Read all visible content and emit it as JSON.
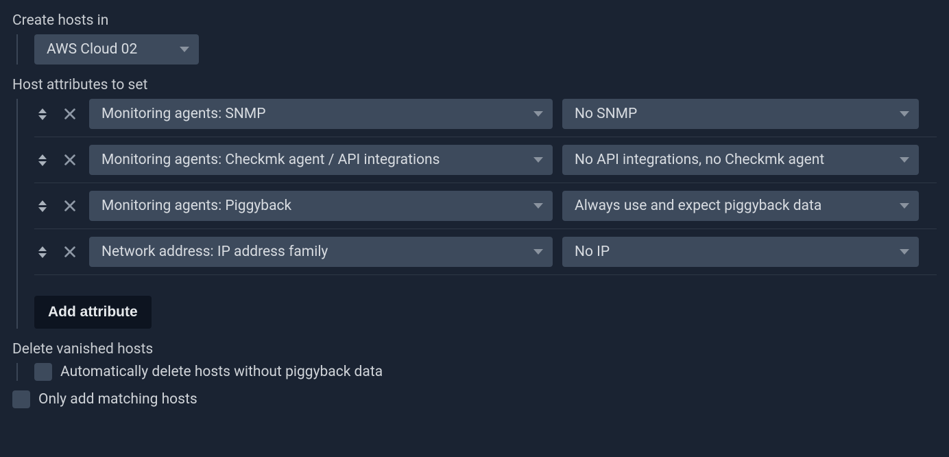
{
  "create_hosts": {
    "label": "Create hosts in",
    "folder": "AWS Cloud 02"
  },
  "host_attributes": {
    "label": "Host attributes to set",
    "rows": [
      {
        "attribute": "Monitoring agents: SNMP",
        "value": "No SNMP"
      },
      {
        "attribute": "Monitoring agents: Checkmk agent / API integrations",
        "value": "No API integrations, no Checkmk agent"
      },
      {
        "attribute": "Monitoring agents: Piggyback",
        "value": "Always use and expect piggyback data"
      },
      {
        "attribute": "Network address: IP address family",
        "value": "No IP"
      }
    ],
    "add_button": "Add attribute"
  },
  "delete_vanished": {
    "label": "Delete vanished hosts",
    "checkbox_label": "Automatically delete hosts without piggyback data"
  },
  "only_matching": {
    "checkbox_label": "Only add matching hosts"
  }
}
